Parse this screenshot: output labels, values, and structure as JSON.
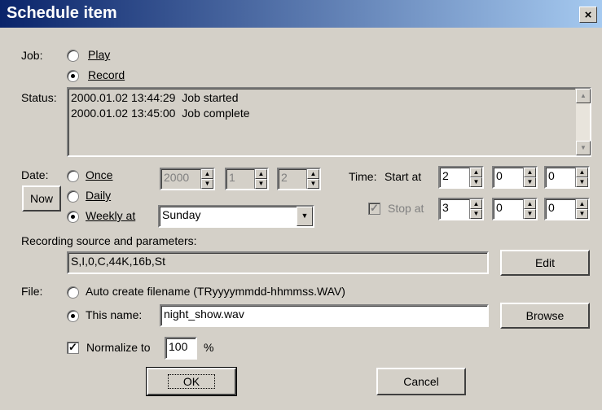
{
  "window": {
    "title": "Schedule item",
    "close_label": "×"
  },
  "job": {
    "label": "Job:",
    "options": [
      {
        "label": "Play",
        "selected": false
      },
      {
        "label": "Record",
        "selected": true
      }
    ]
  },
  "status": {
    "label": "Status:",
    "lines": [
      "2000.01.02 13:44:29  Job started",
      "2000.01.02 13:45:00  Job complete"
    ]
  },
  "date": {
    "label": "Date:",
    "now_button": "Now",
    "options": [
      {
        "label": "Once",
        "selected": false
      },
      {
        "label": "Daily",
        "selected": false
      },
      {
        "label": "Weekly at",
        "selected": true
      }
    ],
    "once_year": "2000",
    "once_month": "1",
    "once_day": "2",
    "weekly_day": "Sunday"
  },
  "time": {
    "label": "Time:",
    "start_label": "Start at",
    "start_hour": "2",
    "start_min": "0",
    "start_sec": "0",
    "stop_label": "Stop at",
    "stop_checked": true,
    "stop_hour": "3",
    "stop_min": "0",
    "stop_sec": "0"
  },
  "recording": {
    "label": "Recording source and parameters:",
    "value": "S,I,0,C,44K,16b,St",
    "edit_button": "Edit"
  },
  "file": {
    "label": "File:",
    "auto_label": "Auto create filename (TRyyyymmdd-hhmmss.WAV)",
    "auto_selected": false,
    "this_name_label": "This name:",
    "this_name_selected": true,
    "name_value": "night_show.wav",
    "browse_button": "Browse"
  },
  "normalize": {
    "checked": true,
    "label": "Normalize to",
    "value": "100",
    "unit": "%"
  },
  "buttons": {
    "ok": "OK",
    "cancel": "Cancel"
  },
  "icons": {
    "spin_up": "▲",
    "spin_down": "▼",
    "dropdown": "▼",
    "check": "✓"
  }
}
